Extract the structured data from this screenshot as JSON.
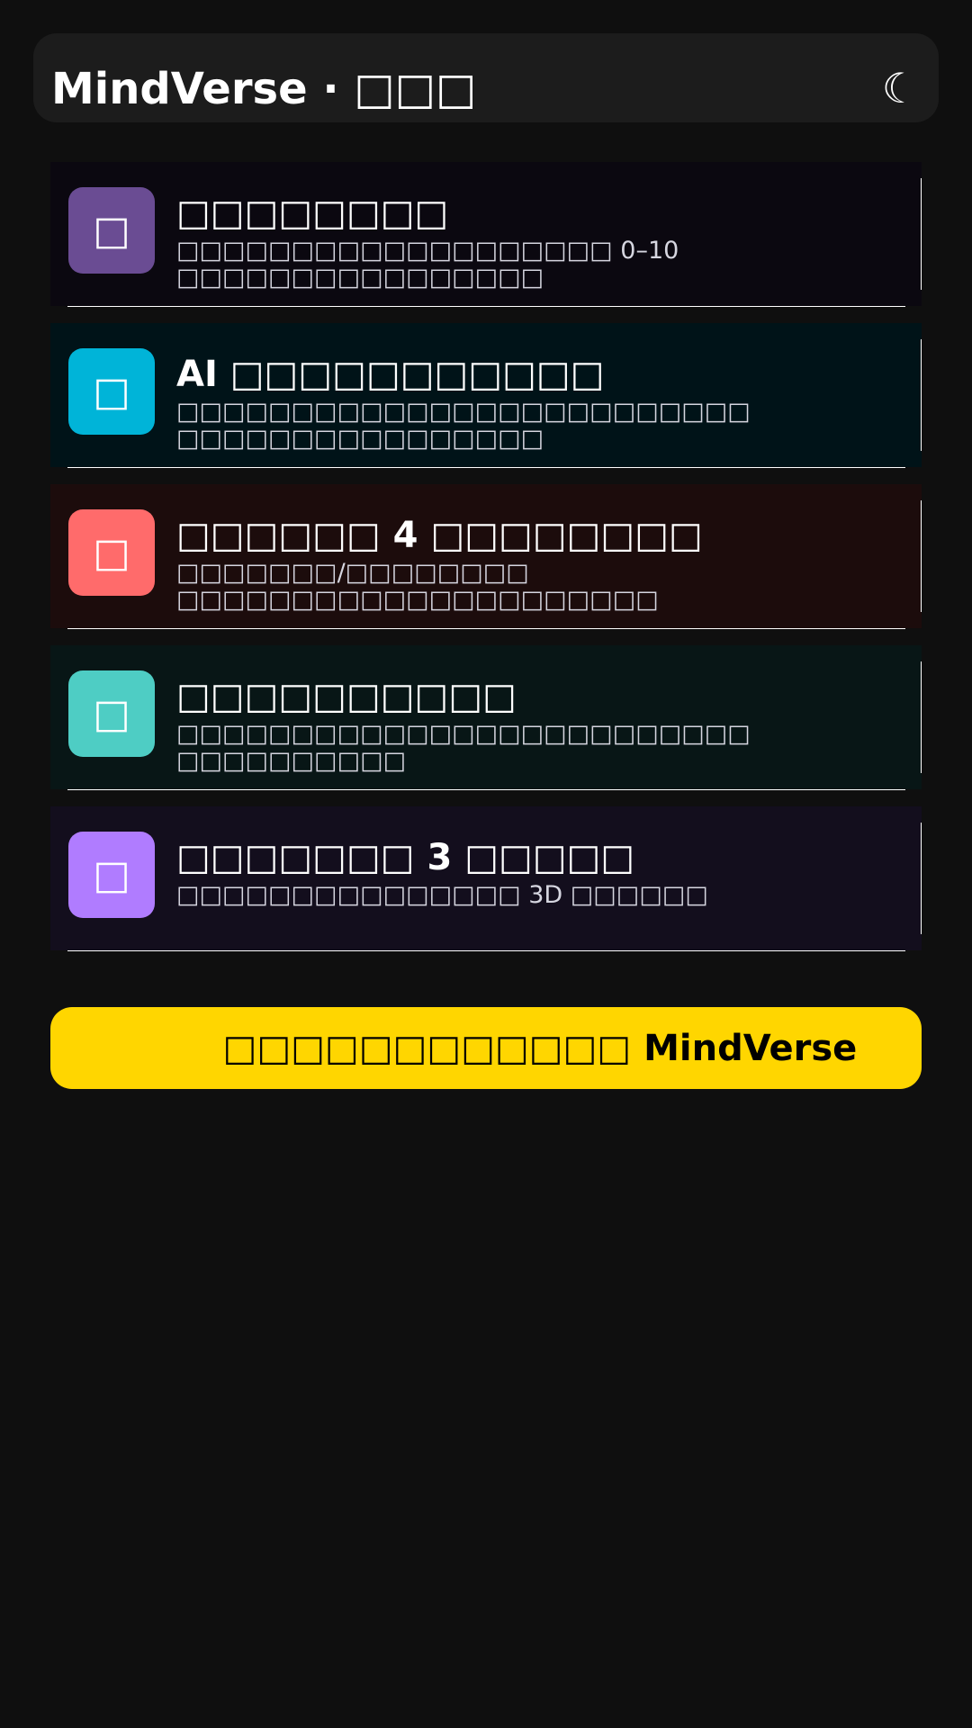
{
  "header": {
    "title": "MindVerse · □□□",
    "theme_icon": "☾"
  },
  "cards": [
    {
      "icon": "□",
      "icon_color": "#6a4c93",
      "bg": "#0b0810",
      "title": "□□□□□□□□",
      "lines": [
        "□□□□□□□□□□□□□□□□□□□ 0–10",
        "□□□□□□□□□□□□□□□□"
      ]
    },
    {
      "icon": "□",
      "icon_color": "#00b4d8",
      "bg": "#001318",
      "title": "AI □□□□□□□□□□□",
      "lines": [
        "□□□□□□□□□□□□□□□□□□□□□□□□□",
        "□□□□□□□□□□□□□□□□"
      ]
    },
    {
      "icon": "□",
      "icon_color": "#ff6b6b",
      "bg": "#1c0c0c",
      "title": "□□□□□□ 4 □□□□□□□□",
      "lines": [
        "□□□□□□□/□□□□□□□□",
        "□□□□□□□□□□□□□□□□□□□□□"
      ]
    },
    {
      "icon": "□",
      "icon_color": "#4ecdc4",
      "bg": "#081616",
      "title": "□□□□□□□□□□",
      "lines": [
        "□□□□□□□□□□□□□□□□□□□□□□□□□",
        "□□□□□□□□□□"
      ]
    },
    {
      "icon": "□",
      "icon_color": "#b07cff",
      "bg": "#130e1d",
      "title": "□□□□□□□ 3 □□□□□",
      "lines": [
        "□□□□□□□□□□□□□□□ 3D □□□□□□"
      ]
    }
  ],
  "cta": {
    "label": "□□□□□□□□□□□□ MindVerse",
    "color": "#ffd600"
  }
}
